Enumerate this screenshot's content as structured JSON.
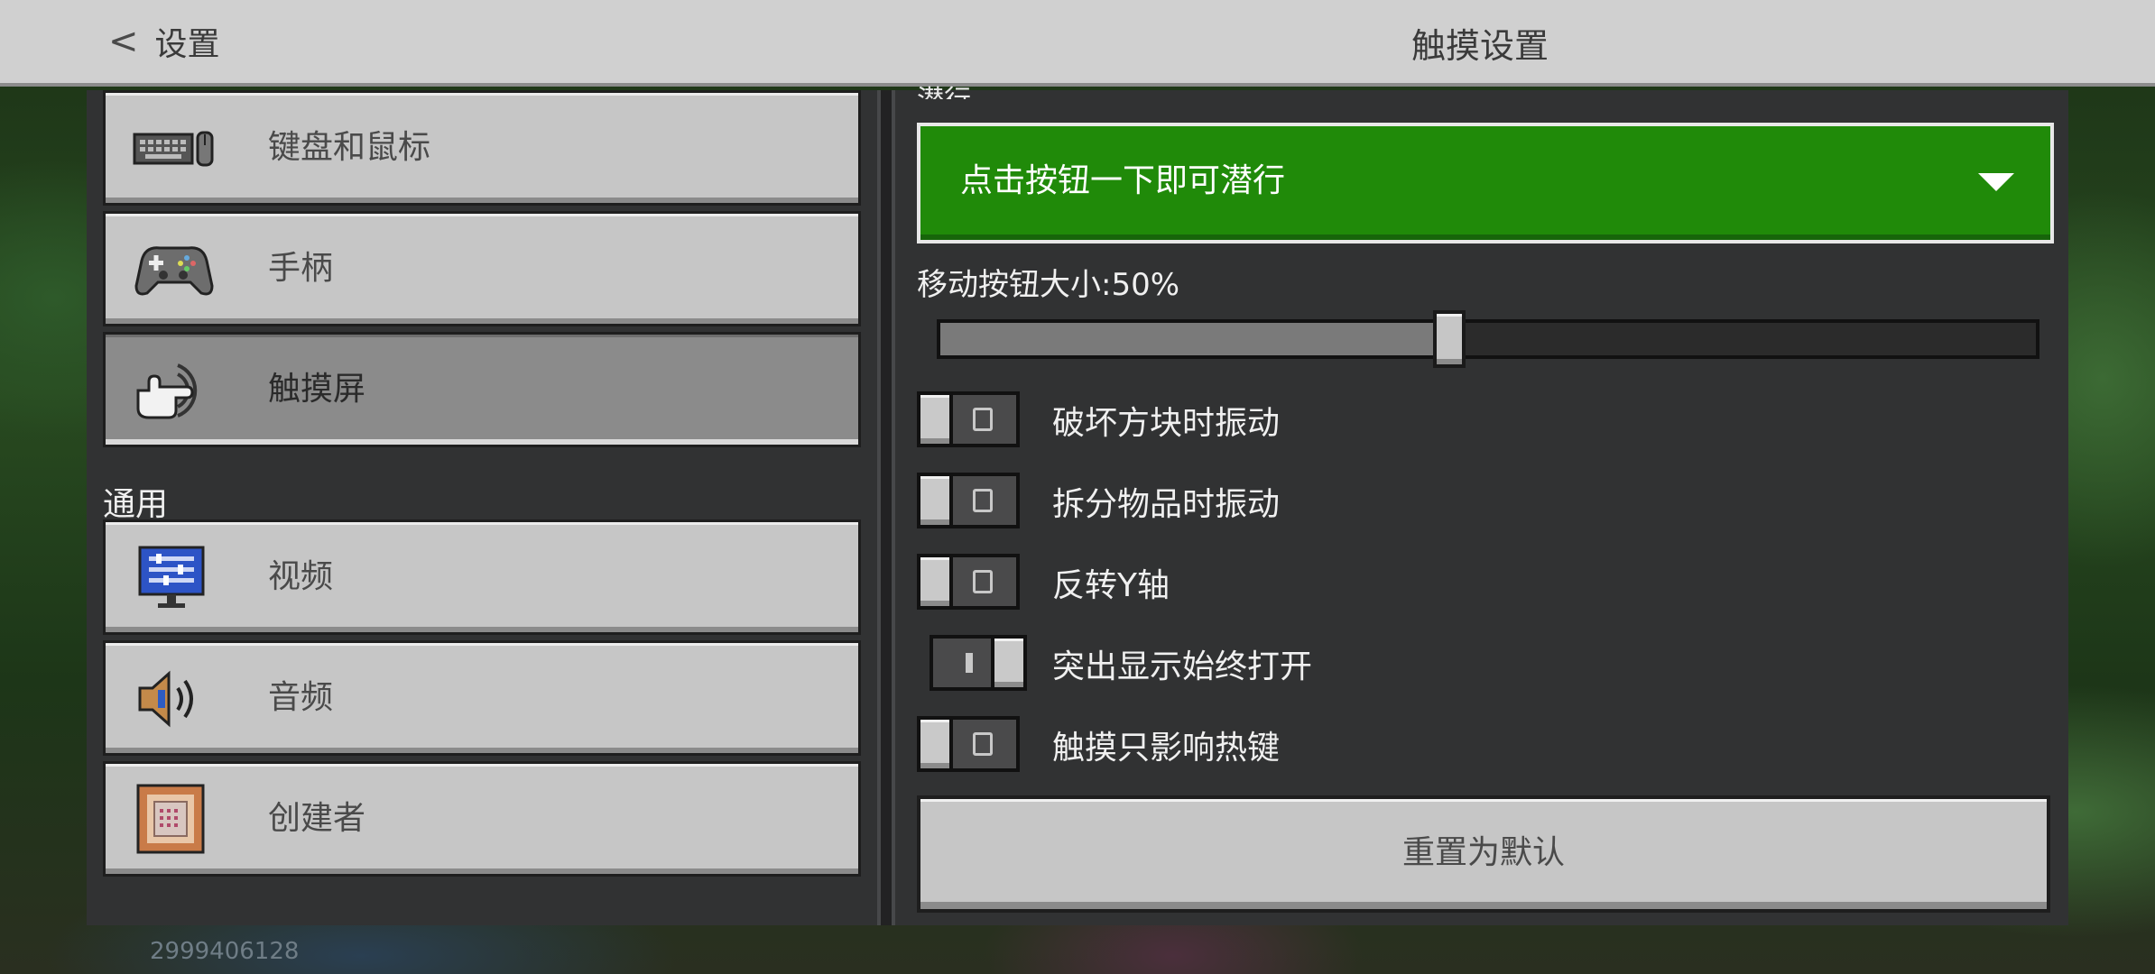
{
  "header": {
    "back_label": "设置",
    "title": "触摸设置"
  },
  "sidebar": {
    "items": [
      {
        "label": "键盘和鼠标",
        "icon": "keyboard-mouse-icon",
        "selected": false
      },
      {
        "label": "手柄",
        "icon": "gamepad-icon",
        "selected": false
      },
      {
        "label": "触摸屏",
        "icon": "touch-hand-icon",
        "selected": true
      }
    ],
    "section_general": "通用",
    "general_items": [
      {
        "label": "视频",
        "icon": "monitor-icon"
      },
      {
        "label": "音频",
        "icon": "speaker-icon"
      },
      {
        "label": "创建者",
        "icon": "command-block-icon"
      }
    ]
  },
  "settings": {
    "sneak_heading": "潜行",
    "sneak_dropdown_value": "点击按钮一下即可潜行",
    "button_size_label": "移动按钮大小:50%",
    "button_size_value": 0.5,
    "toggles": [
      {
        "label": "破坏方块时振动",
        "on": false
      },
      {
        "label": "拆分物品时振动",
        "on": false
      },
      {
        "label": "反转Y轴",
        "on": false
      },
      {
        "label": "突出显示始终打开",
        "on": true
      },
      {
        "label": "触摸只影响热键",
        "on": false
      }
    ],
    "reset_label": "重置为默认"
  },
  "footer": {
    "id_text": "2999406128"
  },
  "colors": {
    "accent_green": "#208a09",
    "panel_bg": "#313233",
    "button_gray": "#c6c6c6"
  }
}
